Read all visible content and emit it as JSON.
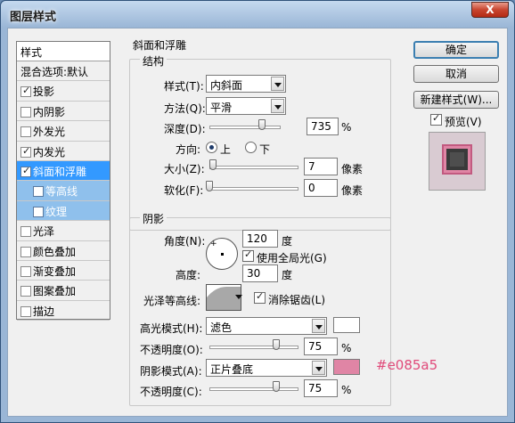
{
  "window": {
    "title": "图层样式",
    "close_label": "X"
  },
  "style_list": {
    "header": "样式",
    "items": [
      {
        "label": "混合选项:默认",
        "checkbox": false,
        "checked": false,
        "state": "normal"
      },
      {
        "label": "投影",
        "checkbox": true,
        "checked": true,
        "state": "normal"
      },
      {
        "label": "内阴影",
        "checkbox": true,
        "checked": false,
        "state": "normal"
      },
      {
        "label": "外发光",
        "checkbox": true,
        "checked": false,
        "state": "normal"
      },
      {
        "label": "内发光",
        "checkbox": true,
        "checked": true,
        "state": "normal"
      },
      {
        "label": "斜面和浮雕",
        "checkbox": true,
        "checked": true,
        "state": "selected"
      },
      {
        "label": "等高线",
        "checkbox": true,
        "checked": false,
        "state": "sub"
      },
      {
        "label": "纹理",
        "checkbox": true,
        "checked": false,
        "state": "sub"
      },
      {
        "label": "光泽",
        "checkbox": true,
        "checked": false,
        "state": "normal"
      },
      {
        "label": "颜色叠加",
        "checkbox": true,
        "checked": false,
        "state": "normal"
      },
      {
        "label": "渐变叠加",
        "checkbox": true,
        "checked": false,
        "state": "normal"
      },
      {
        "label": "图案叠加",
        "checkbox": true,
        "checked": false,
        "state": "normal"
      },
      {
        "label": "描边",
        "checkbox": true,
        "checked": false,
        "state": "normal"
      }
    ]
  },
  "bevel": {
    "section_title": "斜面和浮雕",
    "structure": {
      "title": "结构",
      "style_label": "样式(T):",
      "style_value": "内斜面",
      "technique_label": "方法(Q):",
      "technique_value": "平滑",
      "depth_label": "深度(D):",
      "depth_value": "735",
      "depth_unit": "%",
      "depth_level": 0.74,
      "direction_label": "方向:",
      "direction_up": "上",
      "direction_down": "下",
      "size_label": "大小(Z):",
      "size_value": "7",
      "size_unit": "像素",
      "size_level": 0.04,
      "soften_label": "软化(F):",
      "soften_value": "0",
      "soften_unit": "像素",
      "soften_level": 0
    },
    "shading": {
      "title": "阴影",
      "angle_label": "角度(N):",
      "angle_value": "120",
      "angle_unit": "度",
      "global_light_label": "使用全局光(G)",
      "altitude_label": "高度:",
      "altitude_value": "30",
      "altitude_unit": "度",
      "gloss_contour_label": "光泽等高线:",
      "antialias_label": "消除锯齿(L)",
      "highlight_mode_label": "高光模式(H):",
      "highlight_mode_value": "滤色",
      "highlight_color": "#ffffff",
      "highlight_opacity_label": "不透明度(O):",
      "highlight_opacity_value": "75",
      "highlight_opacity_unit": "%",
      "highlight_opacity_level": 0.75,
      "shadow_mode_label": "阴影模式(A):",
      "shadow_mode_value": "正片叠底",
      "shadow_color": "#e085a5",
      "shadow_opacity_label": "不透明度(C):",
      "shadow_opacity_value": "75",
      "shadow_opacity_unit": "%",
      "shadow_opacity_level": 0.75
    }
  },
  "buttons": {
    "ok": "确定",
    "cancel": "取消",
    "new_style": "新建样式(W)...",
    "preview": "预览(V)"
  },
  "annotation": {
    "text": "#e085a5"
  }
}
